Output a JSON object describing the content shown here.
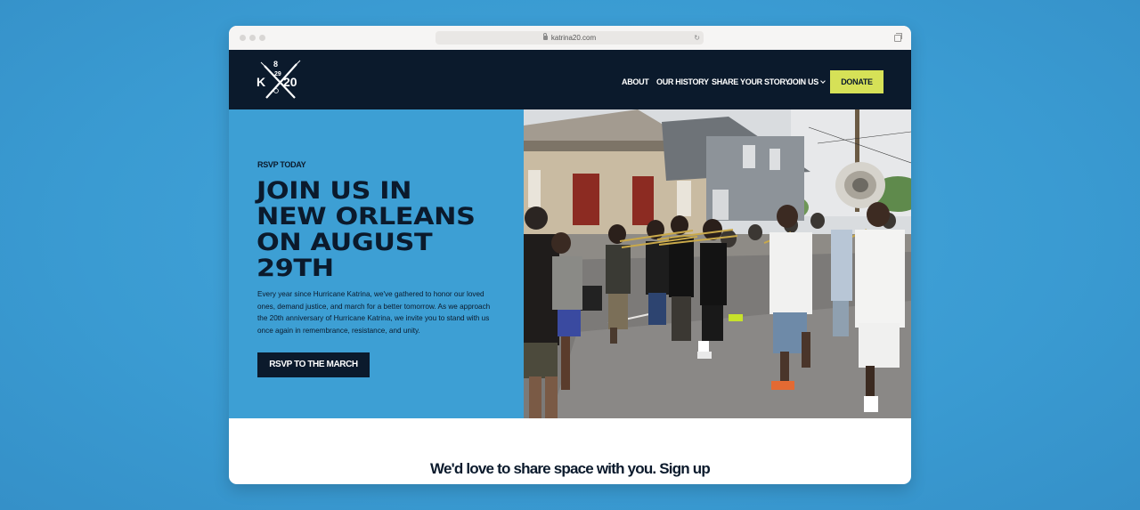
{
  "browser": {
    "url": "katrina20.com"
  },
  "logo": {
    "top_text": "8",
    "mid_text": "29",
    "left_letter": "K",
    "right_number": "20"
  },
  "nav": {
    "items": [
      {
        "label": "ABOUT"
      },
      {
        "label": "OUR HISTORY"
      },
      {
        "label": "SHARE YOUR STORY"
      },
      {
        "label": "JOIN US"
      }
    ],
    "donate_label": "DONATE"
  },
  "hero": {
    "eyebrow": "RSVP TODAY",
    "headline_lines": [
      "JOIN US IN",
      "NEW ORLEANS",
      "ON AUGUST",
      "29TH"
    ],
    "body": "Every year since Hurricane Katrina, we've gathered to honor our loved ones, demand justice, and march for a better tomorrow. As we approach the 20th anniversary of Hurricane Katrina, we invite you to stand with us once again in remembrance, resistance, and unity.",
    "cta_label": "RSVP TO THE MARCH"
  },
  "signup": {
    "heading": "We'd love to share space with you.  Sign up"
  },
  "colors": {
    "page_background": "#3d9fd4",
    "nav_background": "#0b1a2c",
    "hero_panel": "#3d9fd4",
    "donate_button": "#d6e157",
    "text_dark": "#0b1a2c"
  }
}
